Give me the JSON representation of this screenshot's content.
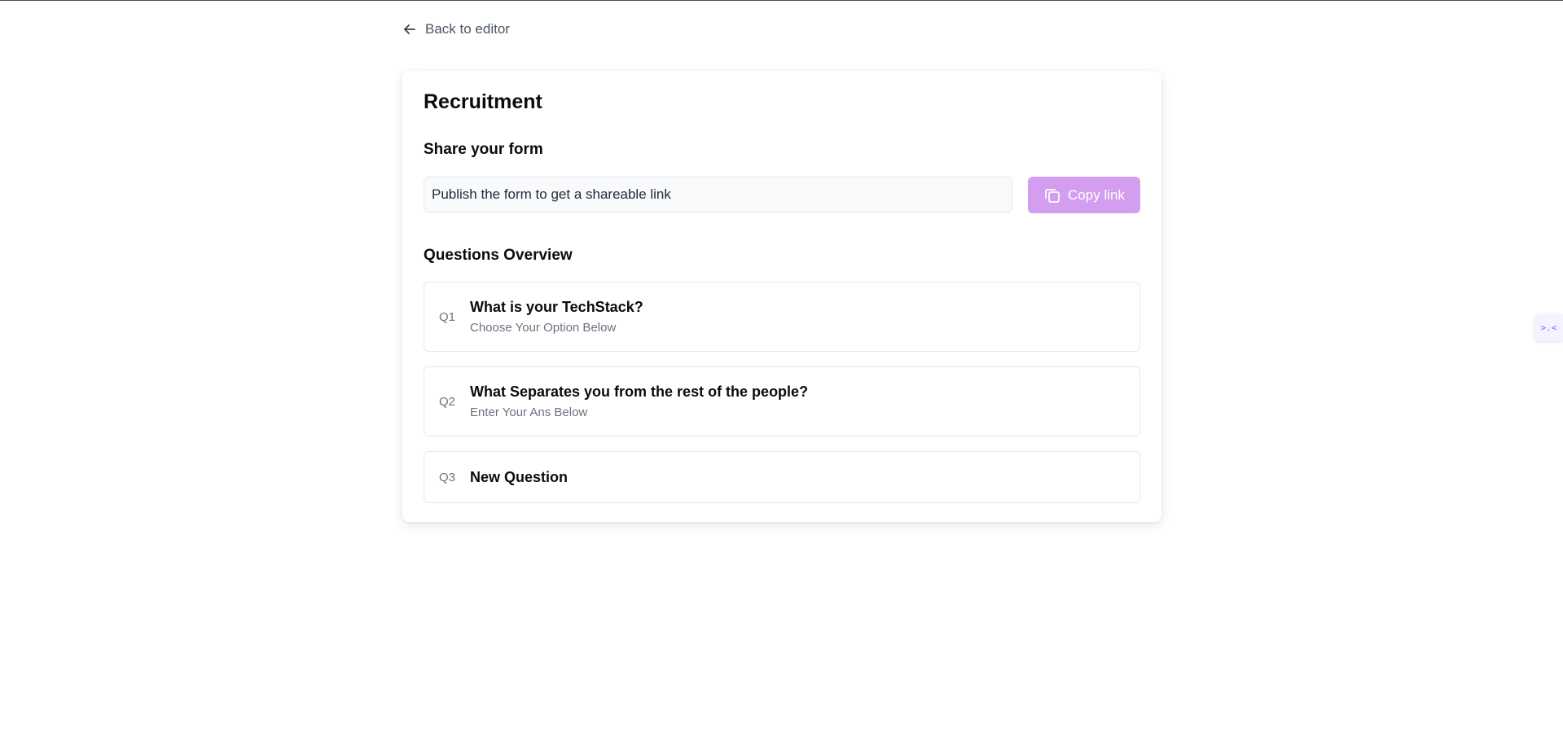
{
  "nav": {
    "back_label": "Back to editor"
  },
  "form": {
    "title": "Recruitment"
  },
  "share": {
    "heading": "Share your form",
    "link_placeholder": "Publish the form to get a shareable link",
    "copy_label": "Copy link",
    "copy_icon": "copy-icon",
    "accent_color": "#d49ef0"
  },
  "questions": {
    "heading": "Questions Overview",
    "items": [
      {
        "number": "Q1",
        "title": "What is your TechStack?",
        "subtitle": "Choose Your Option Below"
      },
      {
        "number": "Q2",
        "title": "What Separates you from the rest of the people?",
        "subtitle": "Enter Your Ans Below"
      },
      {
        "number": "Q3",
        "title": "New Question",
        "subtitle": ""
      }
    ]
  },
  "side_widget": {
    "glyph": ">.<",
    "icon": "floating-widget-icon"
  }
}
